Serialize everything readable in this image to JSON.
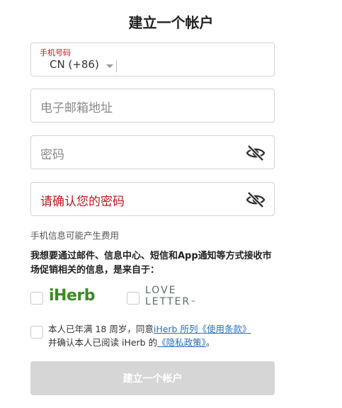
{
  "form": {
    "title": "建立一个帐户",
    "phone": {
      "label": "手机号码",
      "country_code": "CN (+86)"
    },
    "email": {
      "placeholder": "电子邮箱地址"
    },
    "password": {
      "placeholder": "密码"
    },
    "confirm_password": {
      "placeholder": "请确认您的密码"
    },
    "sms_hint": "手机信息可能产生费用",
    "marketing_optin": {
      "text": "我想要通过邮件、信息中心、短信和App通知等方式接收市场促销相关的信息，是来自于：",
      "options": [
        {
          "brand": "iHerb",
          "checked": false
        },
        {
          "brand": "LOVE LETTER",
          "line1": "LOVE",
          "line2": "LETTER",
          "mark": "™",
          "checked": false
        }
      ]
    },
    "terms": {
      "prefix": "本人已年满 18 周岁，同意",
      "link1": "iHerb 所列《使用条款》",
      "middle": "并确认本人已阅读 iHerb 的",
      "link2": "《隐私政策》",
      "suffix": "。",
      "checked": false
    },
    "submit_label": "建立一个帐户"
  },
  "colors": {
    "error_red": "#c0171c",
    "iherb_green": "#3a8a22",
    "link_blue": "#2a6ebb",
    "disabled_button": "#d6d6d6"
  },
  "icons": {
    "password_visibility": "eye-slash-icon",
    "country_dropdown": "chevron-down-icon"
  }
}
